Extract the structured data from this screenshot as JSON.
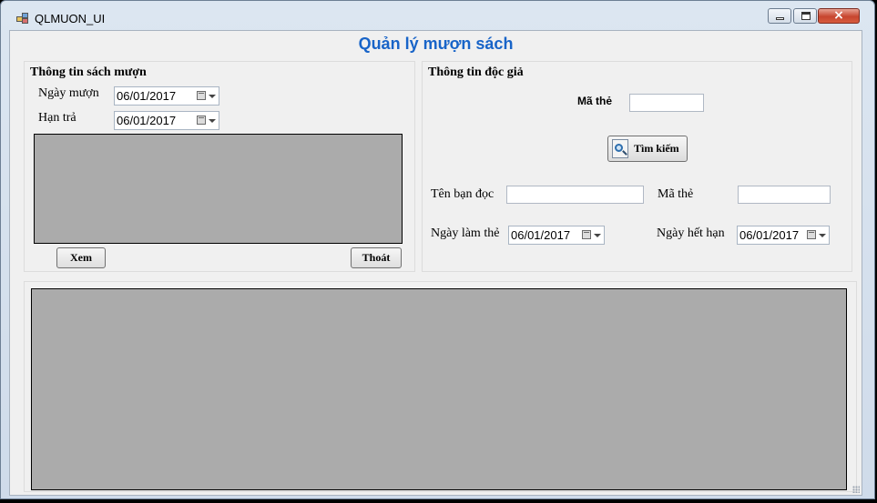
{
  "window": {
    "title": "QLMUON_UI",
    "close_glyph": "×"
  },
  "heading": "Quản lý mượn sách",
  "loan_group": {
    "title": "Thông tin sách mượn",
    "borrow_date_label": "Ngày mượn",
    "borrow_date_value": "06/01/2017",
    "due_date_label": "Hạn trả",
    "due_date_value": "06/01/2017",
    "view_button": "Xem",
    "exit_button": "Thoát"
  },
  "reader_group": {
    "title": "Thông tin độc giả",
    "card_id_label": "Mã thẻ",
    "card_id_value": "",
    "search_button": "Tìm kiếm",
    "reader_name_label": "Tên bạn đọc",
    "reader_name_value": "",
    "card_id_label_2": "Mã thẻ",
    "card_id_value_2": "",
    "issue_date_label": "Ngày làm thẻ",
    "issue_date_value": "06/01/2017",
    "expiry_date_label": "Ngày hết hạn",
    "expiry_date_value": "06/01/2017"
  },
  "icons": {
    "app": "app-icon",
    "search": "search-icon",
    "calendar": "calendar-icon",
    "dropdown": "chevron-down-icon"
  },
  "colors": {
    "heading": "#1864c8",
    "grid_background": "#ababab",
    "client_background": "#f0f0f0"
  }
}
